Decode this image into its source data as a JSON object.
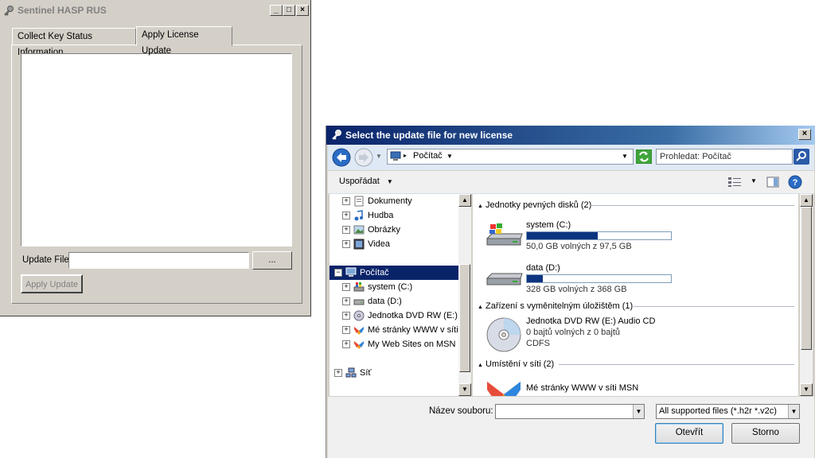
{
  "hasp": {
    "title": "Sentinel HASP RUS",
    "sys_min": "_",
    "sys_max": "□",
    "sys_close": "×",
    "tabs": [
      {
        "label": "Collect Key Status Information"
      },
      {
        "label": "Apply License Update"
      }
    ],
    "update_file_label": "Update File",
    "update_file_value": "",
    "browse_label": "...",
    "apply_label": "Apply Update"
  },
  "dialog": {
    "title": "Select the update file for new license",
    "close": "×",
    "path": "Počítač",
    "search_placeholder": "Prohledat: Počítač",
    "organize_label": "Uspořádat",
    "tree": [
      {
        "label": "Dokumenty"
      },
      {
        "label": "Hudba"
      },
      {
        "label": "Obrázky"
      },
      {
        "label": "Videa"
      },
      {
        "label": "Počítač"
      },
      {
        "label": "system (C:)"
      },
      {
        "label": "data (D:)"
      },
      {
        "label": "Jednotka DVD RW (E:) A"
      },
      {
        "label": "Mé stránky WWW v síti N"
      },
      {
        "label": "My Web Sites on MSN"
      },
      {
        "label": "Síť"
      }
    ],
    "groups": {
      "hdd": "Jednotky pevných disků (2)",
      "removable": "Zařízení s vyměnitelným úložištěm (1)",
      "network": "Umístění v síti (2)"
    },
    "drives": [
      {
        "name": "system (C:)",
        "free": "50,0 GB volných z 97,5 GB",
        "used_fraction": 0.49
      },
      {
        "name": "data (D:)",
        "free": "328 GB volných z 368 GB",
        "used_fraction": 0.11
      }
    ],
    "dvd": {
      "name": "Jednotka DVD RW (E:) Audio CD",
      "free": "0 bajtů volných z 0 bajtů",
      "fs": "CDFS"
    },
    "network_item": {
      "name": "Mé stránky WWW v síti MSN"
    },
    "filename_label": "Název souboru:",
    "filename_value": "",
    "filter_value": "All supported files (*.h2r *.v2c)",
    "open_label": "Otevřít",
    "cancel_label": "Storno"
  }
}
